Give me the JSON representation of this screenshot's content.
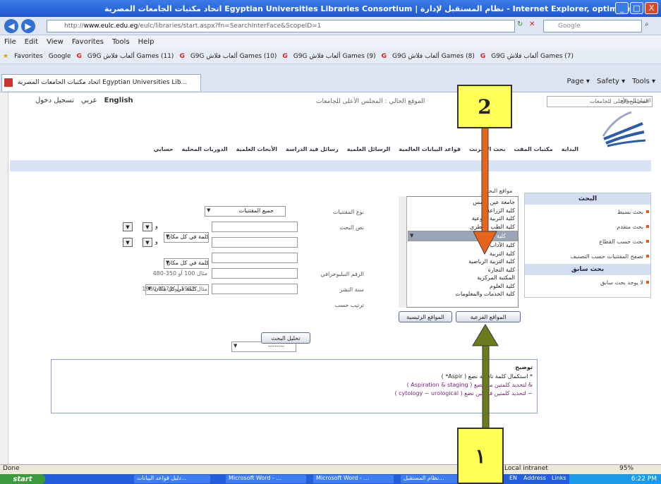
{
  "window": {
    "title": "اتحاد مكتبات الجامعات المصرية Egyptian Universities Libraries Consortium | نظام المستقبل لإدارة - Internet Explorer, optimized",
    "min": "_",
    "max": "□",
    "close": "X"
  },
  "address": {
    "domain": "www.eulc.edu.eg",
    "path": "/eulc/libraries/start.aspx?fn=SearchInterFace&ScopeID=1",
    "search_placeholder": "Google"
  },
  "menu": [
    "File",
    "Edit",
    "View",
    "Favorites",
    "Tools",
    "Help"
  ],
  "favorites": {
    "label": "Favorites",
    "items": [
      "Google",
      "G9G ألعاب فلاش Games (11)",
      "G9G ألعاب فلاش Games (10)",
      "G9G ألعاب فلاش Games (9)",
      "G9G ألعاب فلاش Games (8)",
      "G9G ألعاب فلاش Games (7)"
    ]
  },
  "tab": {
    "label": "اتحاد مكتبات الجامعات المصرية Egyptian Universities Lib..."
  },
  "commands": [
    "Page ▾",
    "Safety ▾",
    "Tools ▾"
  ],
  "page": {
    "top_links": [
      "تسجيل دخول",
      "عربي",
      "English"
    ],
    "breadcrumb": "الموقع الحالي : المجلس الأعلى للجامعات",
    "site_select": "المجلس الأعلى للجامعات",
    "site_label": "اختيار الموقع",
    "nav": [
      "البداية",
      "مكتبات المقت",
      "بحث الانترنت",
      "قواعد البيانات العالمية",
      "الرسائل العلمية",
      "رسائل قيد الدراسة",
      "الأبحاث العلمية",
      "الدوريات المحلية",
      "حسابي"
    ],
    "side": {
      "head1": "البحث",
      "items": [
        "بحث بسيط",
        "بحث متقدم",
        "بحث حسب القطاع",
        "تصفح المقتنيات حسب التصنيف"
      ],
      "head2": "بحث سابق",
      "prev": "لا يوجد بحث سابق"
    },
    "list_label": "مواقع البحث",
    "list": [
      "جامعة عين شمس",
      "كلية الزراعة",
      "كلية التربية النوعية",
      "كلية الطب البيطري",
      "كلية الهندسة",
      "كلية الآداب",
      "كلية التربية",
      "كلية التربية الرياضية",
      "كلية التجارة",
      "المكتبة المركزية",
      "كلية العلوم",
      "كلية الخدمات والمعلومات"
    ],
    "selected_index": 4,
    "btn_sub": "المواقع الفرعية",
    "btn_main": "المواقع الرئيسية",
    "form": {
      "type_label": "نوع المقتنيات",
      "type_value": "جميع المقتنيات",
      "text_label": "نص البحث",
      "word_opt": "كلمة في كل مكان",
      "and_opt": "و",
      "biblio_label": "الرقم الببليوجرافي",
      "biblio_hint": "مثال 100 أو 350-480",
      "year_label": "سنة النشر",
      "year_hint": "مثال 1987 أو 1970-1980",
      "sort_label": "ترتيب حسب",
      "sort_value": "--------"
    },
    "search_btn": "تحليل البحث",
    "notes_label": "توضيح",
    "notes": [
      "( *Aspir ) استكمال كلمة ناقصة نضع *",
      "( Aspiration & staging ) لتحديد كلمتين معا نضع &",
      "( cytology ~ urological ) لتحديد كلمتين قريبتين نضع ~"
    ]
  },
  "status": {
    "left": "Done",
    "zone": "Local intranet",
    "zoom": "95%"
  },
  "taskbar": {
    "start": "start",
    "tasks": [
      "دليل قواعد البيانات...",
      "Microsoft Word - ...",
      "Microsoft Word - ...",
      "نظام المستقبل..."
    ],
    "clock": "6:22 PM",
    "lang": "EN",
    "addr": "Address",
    "links": "Links"
  },
  "callouts": {
    "one": "١",
    "two": "2",
    "arrow_down_color": "#e8641a",
    "arrow_up_color": "#6b7a1e"
  }
}
